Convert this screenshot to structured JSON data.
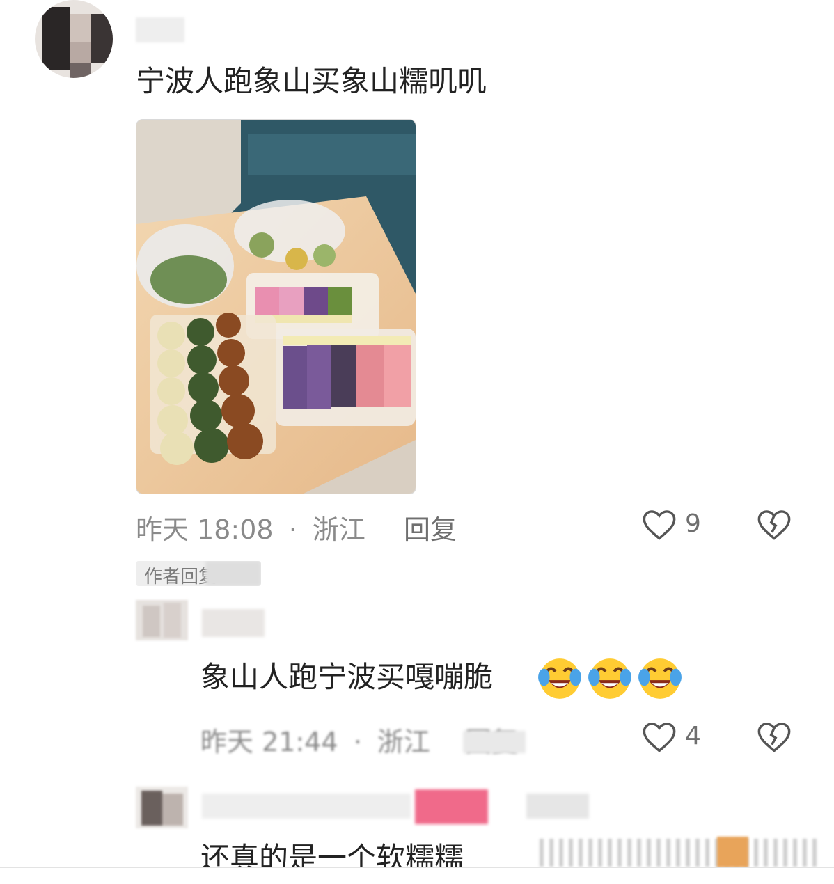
{
  "comment1": {
    "text": "宁波人跑象山买象山糯叽叽",
    "time": "昨天 18:08",
    "location": "浙江",
    "separator": "·",
    "reply_label": "回复",
    "like_count": "9"
  },
  "author_badge": "作者回复",
  "reply1": {
    "text": "象山人跑宁波买嘎嘣脆",
    "emoji": [
      "crying-laughing-face",
      "crying-laughing-face",
      "crying-laughing-face"
    ],
    "time": "昨天 21:44",
    "location": "浙江",
    "separator": "·",
    "reply_label": "回复",
    "like_count": "4"
  },
  "comment2": {
    "text": "还真的是一个软糯糯"
  },
  "icons": [
    "heart-outline-icon",
    "broken-heart-icon"
  ],
  "colors": {
    "text": "#222222",
    "meta": "#8a8a8a",
    "icon": "#555555",
    "highlight_block": "#f06a8a"
  }
}
